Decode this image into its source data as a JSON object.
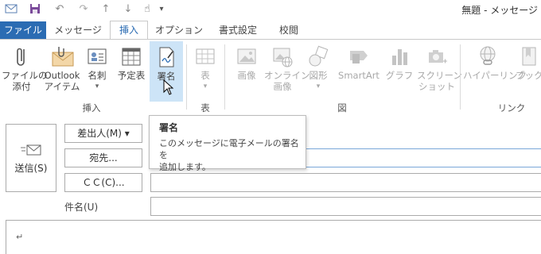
{
  "window": {
    "title": "無題 - メッセージ"
  },
  "qat": {
    "icons": [
      "envelope-icon",
      "save-icon",
      "undo-icon",
      "redo-icon",
      "up-arrow-icon",
      "down-arrow-icon",
      "touch-mode-icon",
      "customize-qat-icon"
    ]
  },
  "tabs": [
    {
      "label": "ファイル",
      "state": "file"
    },
    {
      "label": "メッセージ",
      "state": "normal"
    },
    {
      "label": "挿入",
      "state": "active"
    },
    {
      "label": "オプション",
      "state": "normal"
    },
    {
      "label": "書式設定",
      "state": "normal"
    },
    {
      "label": "校閲",
      "state": "normal"
    }
  ],
  "ribbon": {
    "groups": {
      "insert": "挿入",
      "table": "表",
      "illustrations": "図",
      "links": "リンク"
    },
    "buttons": {
      "attach_line1": "ファイルの",
      "attach_line2": "添付",
      "outlook_line1": "Outlook",
      "outlook_line2": "アイテム",
      "card_line1": "名刺",
      "calendar": "予定表",
      "signature": "署名",
      "table": "表",
      "pictures": "画像",
      "online_line1": "オンライン",
      "online_line2": "画像",
      "shapes": "図形",
      "smartart": "SmartArt",
      "chart": "グラフ",
      "screenshot_line1": "スクリーン",
      "screenshot_line2": "ショット",
      "hyperlink": "ハイパーリンク",
      "bookmark": "ブックマー"
    },
    "dropdown_glyph": "▾"
  },
  "tooltip": {
    "title": "署名",
    "line1": "このメッセージに電子メールの署名を",
    "line2": "追加します。"
  },
  "compose": {
    "send_label": "送信(S)",
    "from_label": "差出人(M) ▾",
    "to_label": "宛先...",
    "cc_label": "ＣＣ(C)...",
    "subject_label": "件名(U)",
    "body_mark": "↵"
  },
  "colors": {
    "accent": "#2b6cb3",
    "hover": "#cde4f7",
    "disabled": "#a8a8a8"
  }
}
